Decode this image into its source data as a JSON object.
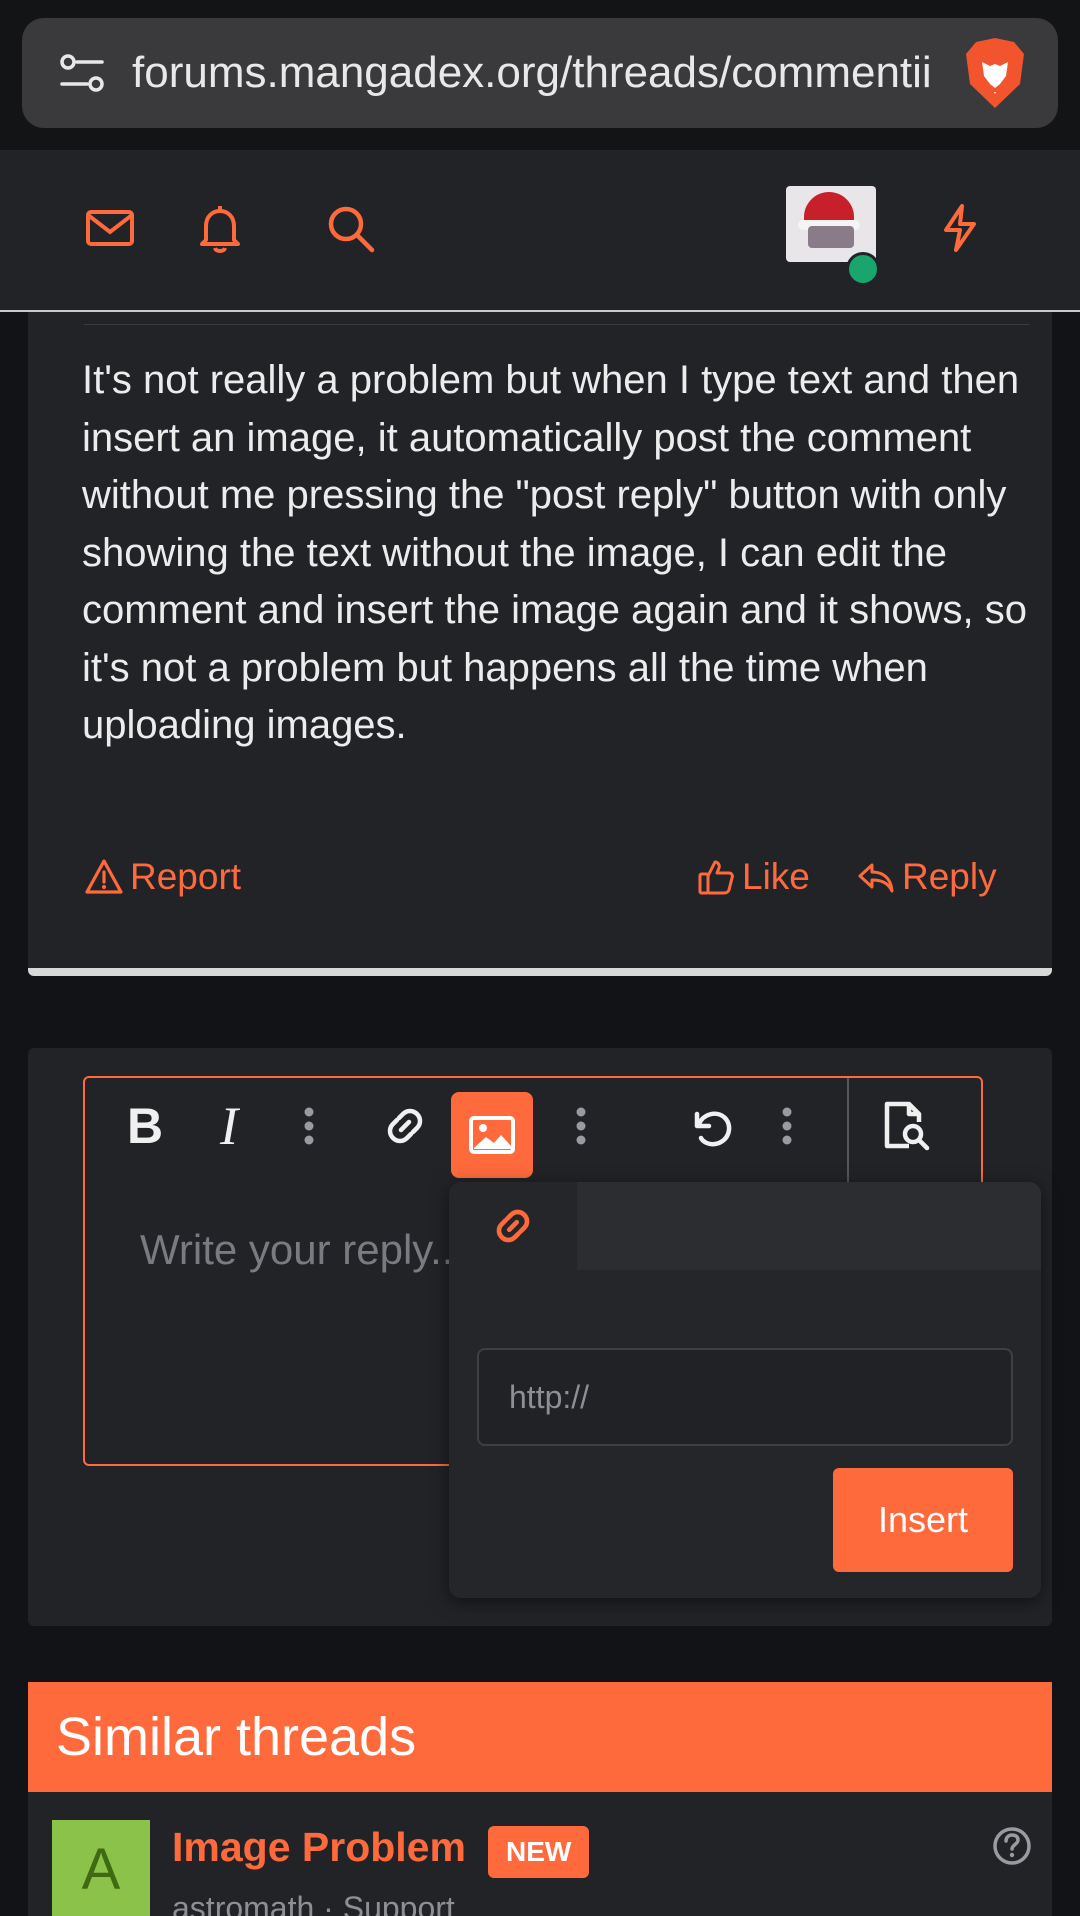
{
  "browser": {
    "url": "forums.mangadex.org/threads/commentii",
    "icons": {
      "site_settings": "tune-icon",
      "browser_logo": "brave-lion-icon"
    }
  },
  "nav": {
    "icons": [
      "mail-icon",
      "bell-icon",
      "search-icon",
      "avatar",
      "lightning-icon"
    ],
    "online_status_color": "#19a56b"
  },
  "post": {
    "body": "It's not really a problem but when I type text and then insert an image, it automatically post the comment without me pressing the \"post reply\" button with only showing the text without the image, I can edit the comment and insert the image again and it shows, so it's not a problem but happens all the time when uploading images.",
    "report_label": "Report",
    "like_label": "Like",
    "reply_label": "Reply"
  },
  "editor": {
    "bold_label": "B",
    "italic_label": "I",
    "placeholder": "Write your reply...",
    "toolbar_icons": [
      "bold",
      "italic",
      "more-vertical-icon",
      "link-icon",
      "image-icon",
      "more-vertical-icon",
      "undo-icon",
      "more-vertical-icon",
      "preview-icon"
    ]
  },
  "image_popup": {
    "url_placeholder": "http://",
    "insert_label": "Insert"
  },
  "similar": {
    "header": "Similar threads",
    "threads": [
      {
        "avatar_letter": "A",
        "title": "Image Problem",
        "badge": "NEW",
        "meta": "astromath · Support"
      }
    ]
  },
  "colors": {
    "accent": "#ff6a3d",
    "background": "#121317",
    "panel": "#222327"
  }
}
